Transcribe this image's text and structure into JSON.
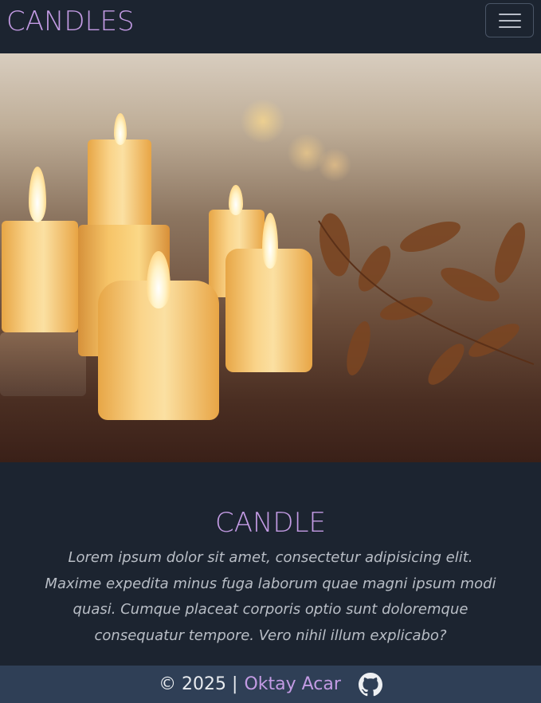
{
  "navbar": {
    "brand": "CANDLES",
    "toggler_icon": "hamburger-menu-icon"
  },
  "hero": {
    "image_description_icon": "candles-photo"
  },
  "content": {
    "title": "CANDLE",
    "text": "Lorem ipsum dolor sit amet, consectetur adipisicing elit. Maxime expedita minus fuga laborum quae magni ipsum modi quasi. Cumque placeat corporis optio sunt doloremque consequatur tempore. Vero nihil illum explicabo?"
  },
  "footer": {
    "copyright": "© 2025 |",
    "author": "Oktay Acar",
    "github_icon": "github-icon"
  },
  "colors": {
    "background": "#1c2430",
    "accent": "#c39be4",
    "footer_bg": "#2f3f56"
  }
}
